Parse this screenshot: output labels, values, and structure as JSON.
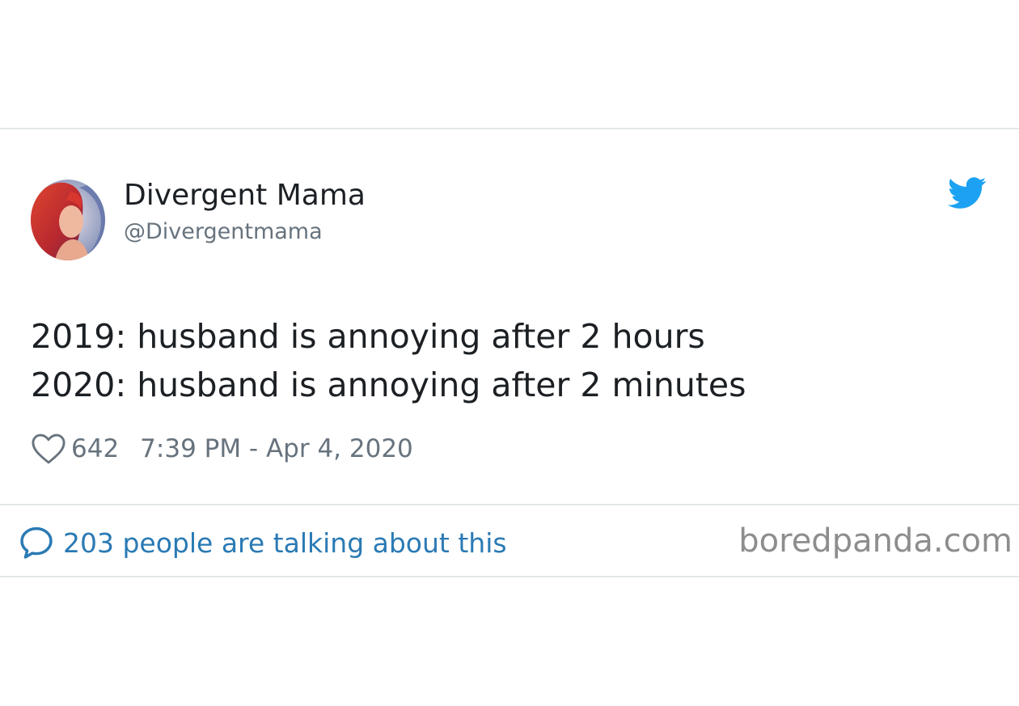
{
  "tweet": {
    "display_name": "Divergent Mama",
    "handle": "@Divergentmama",
    "text_lines": [
      "2019: husband is annoying after 2 hours",
      "2020: husband is annoying after 2 minutes"
    ],
    "likes": "642",
    "timestamp": "7:39 PM - Apr 4, 2020",
    "talking": "203 people are talking about this"
  },
  "watermark": "boredpanda.com",
  "icons": {
    "brand": "twitter-bird-icon",
    "like": "heart-icon",
    "reply": "speech-bubble-icon"
  },
  "colors": {
    "twitter_blue": "#1da1f2",
    "link_blue": "#2a7ab4",
    "text": "#1c2024",
    "muted": "#67737e",
    "watermark": "#8d8d8d"
  }
}
